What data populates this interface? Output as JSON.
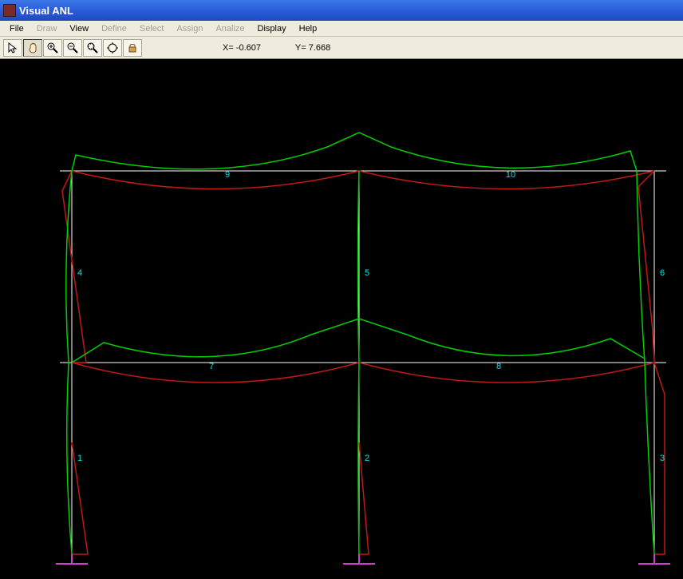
{
  "window": {
    "title": "Visual ANL"
  },
  "menu": {
    "file": "File",
    "draw": "Draw",
    "view": "View",
    "define": "Define",
    "select": "Select",
    "assign": "Assign",
    "analize": "Analize",
    "display": "Display",
    "help": "Help"
  },
  "toolbar": {
    "icons": {
      "pointer": "pointer-icon",
      "pan": "pan-icon",
      "zoom_in": "zoom-in-icon",
      "zoom_out": "zoom-out-icon",
      "zoom_window": "zoom-window-icon",
      "zoom_extents": "zoom-extents-icon",
      "lock": "lock-icon"
    }
  },
  "status": {
    "x_label": "X= -0.607",
    "y_label": "Y= 7.668"
  },
  "model": {
    "colors": {
      "structure": "#ffffff",
      "deflected": "#00d000",
      "moment": "#c01818",
      "support": "#d040d0",
      "label": "#00e4e8"
    },
    "members": {
      "m1": "1",
      "m2": "2",
      "m3": "3",
      "m4": "4",
      "m5": "5",
      "m6": "6",
      "m7": "7",
      "m8": "8",
      "m9": "9",
      "m10": "10"
    }
  }
}
